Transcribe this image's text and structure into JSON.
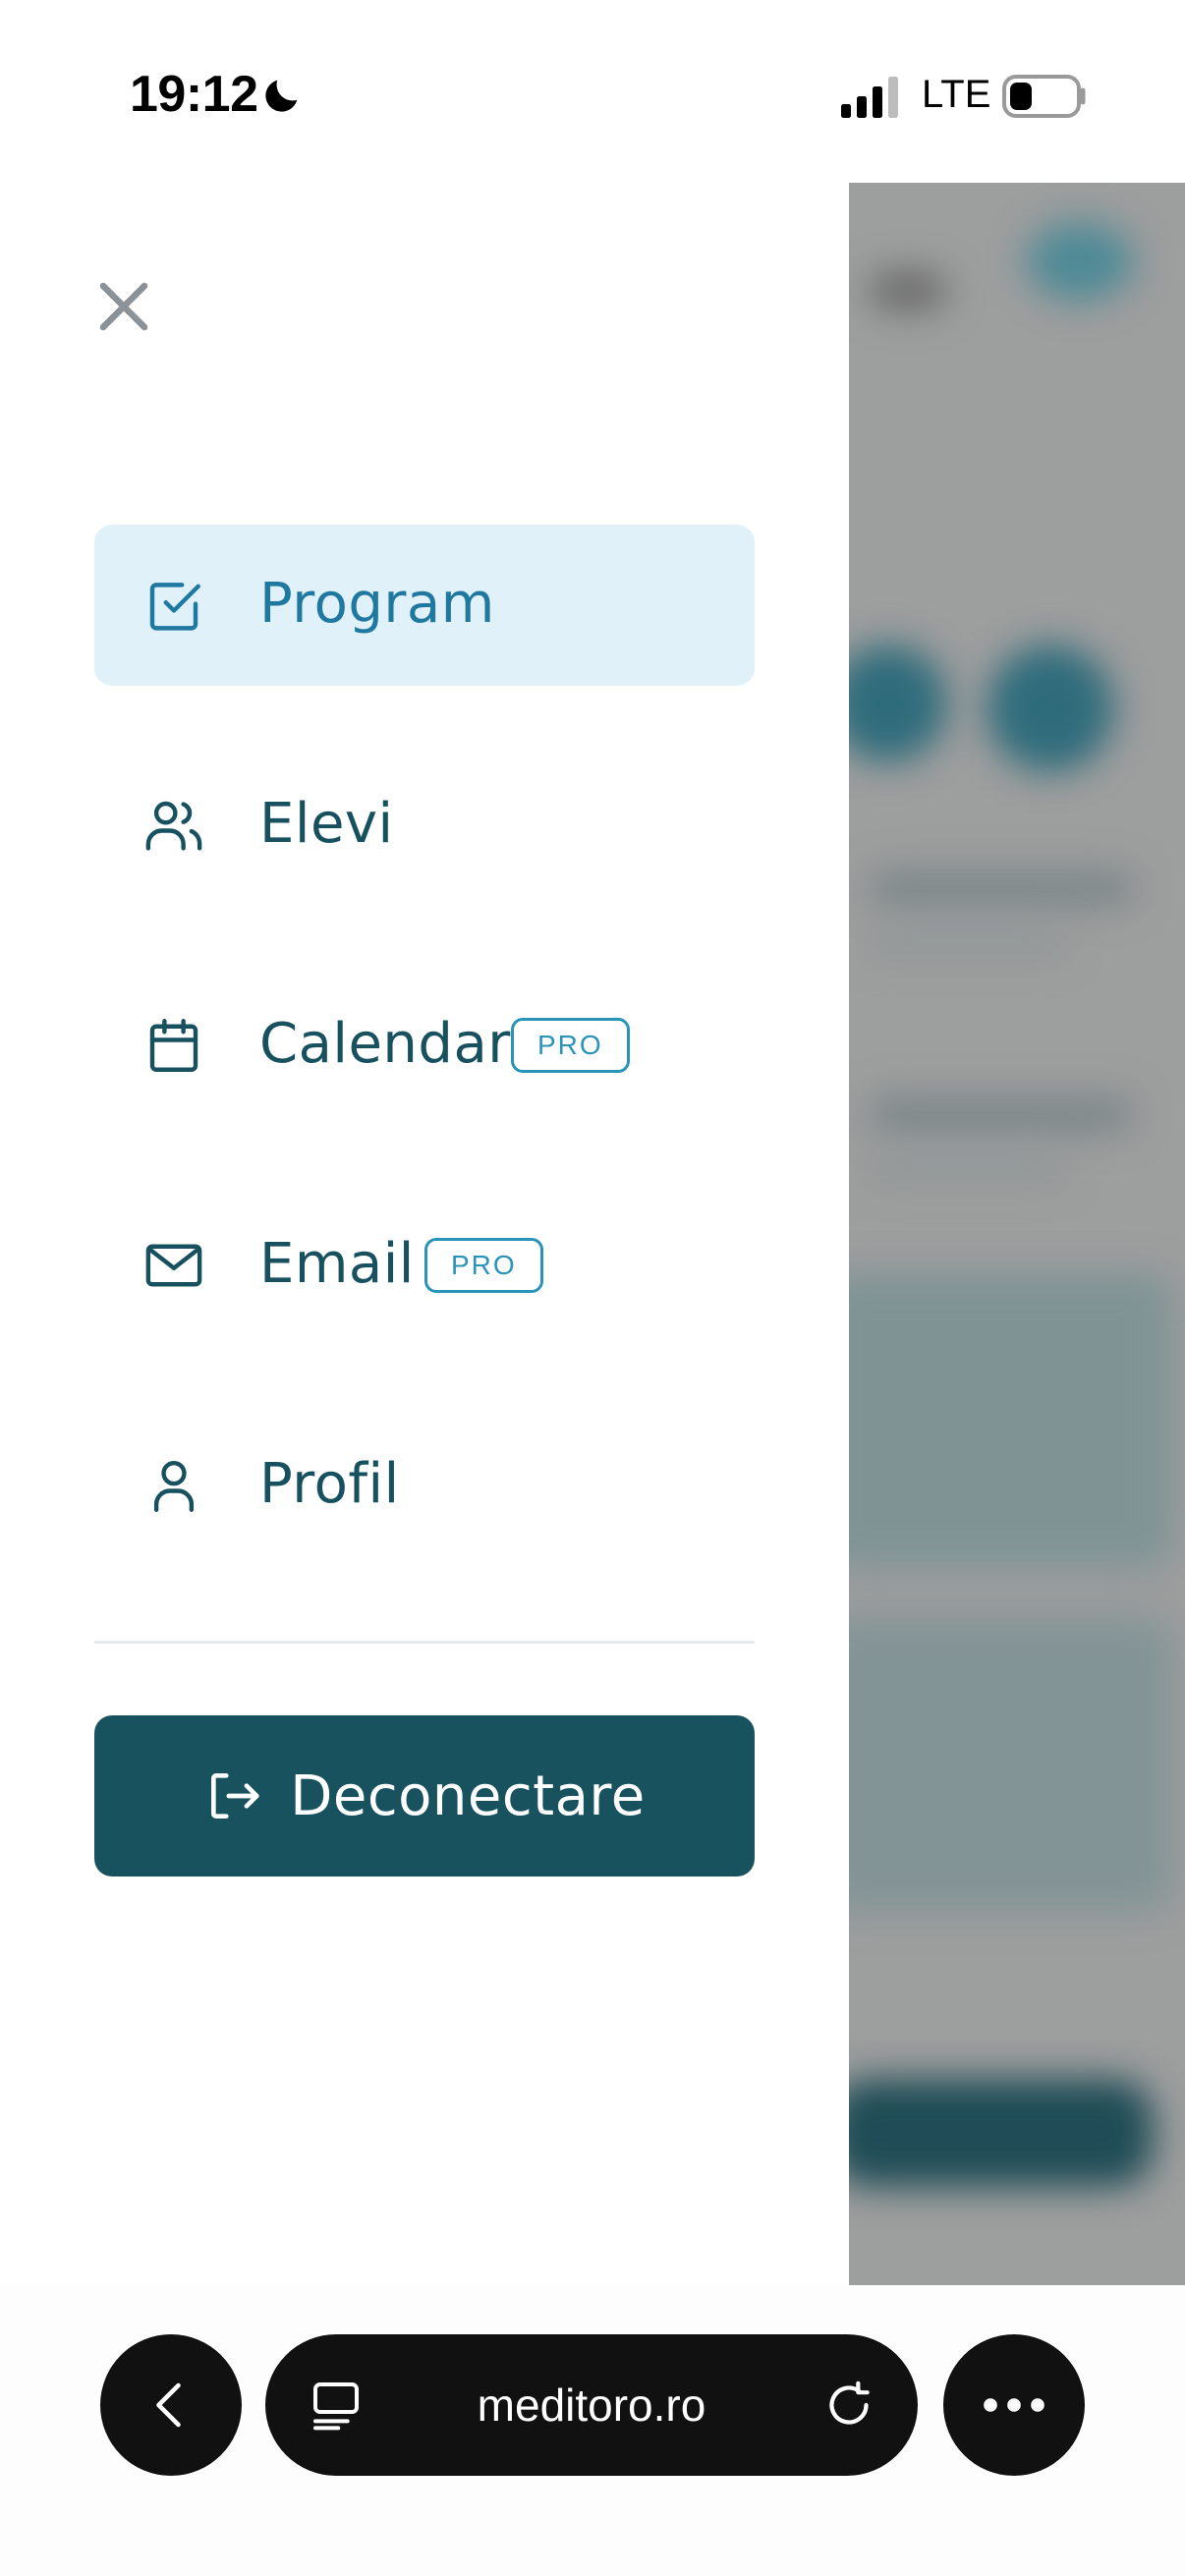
{
  "status_bar": {
    "time": "19:12",
    "network": "LTE"
  },
  "drawer": {
    "close_icon": "close-icon",
    "nav_items": [
      {
        "label": "Program",
        "icon": "checkbox-icon",
        "active": true,
        "badge": null
      },
      {
        "label": "Elevi",
        "icon": "users-icon",
        "active": false,
        "badge": null
      },
      {
        "label": "Calendar",
        "icon": "calendar-icon",
        "active": false,
        "badge": "PRO"
      },
      {
        "label": "Email",
        "icon": "mail-icon",
        "active": false,
        "badge": "PRO"
      },
      {
        "label": "Profil",
        "icon": "user-icon",
        "active": false,
        "badge": null
      }
    ],
    "logout": {
      "label": "Deconectare",
      "icon": "logout-icon"
    }
  },
  "browser": {
    "url": "meditoro.ro",
    "back_icon": "chevron-left-icon",
    "reader_icon": "reader-icon",
    "reload_icon": "reload-icon",
    "more_icon": "more-icon"
  },
  "colors": {
    "brand_dark": "#18525f",
    "nav_text": "#17505e",
    "active_text": "#1e78a0",
    "active_bg": "#e0f1f9",
    "badge": "#2a93b8",
    "backdrop": "#9d9e9e"
  }
}
